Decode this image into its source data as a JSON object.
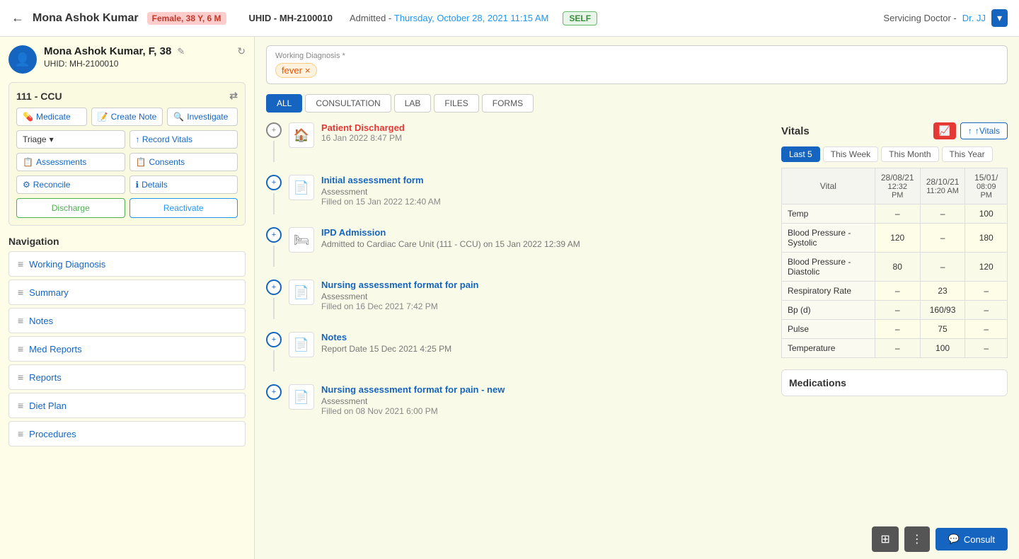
{
  "header": {
    "back_icon": "←",
    "patient_name": "Mona Ashok Kumar",
    "gender_badge": "Female, 38 Y, 6 M",
    "uhid_label": "UHID -",
    "uhid_value": "MH-2100010",
    "admitted_label": "Admitted -",
    "admitted_date": "Thursday, October 28, 2021 11:15 AM",
    "self_badge": "SELF",
    "servicing_label": "Servicing Doctor -",
    "servicing_doctor": "Dr. JJ",
    "dropdown_icon": "▾"
  },
  "patient_card": {
    "name": "Mona Ashok Kumar, F, 38",
    "uhid_prefix": "UHID:",
    "uhid": "MH-2100010",
    "edit_icon": "✎",
    "refresh_icon": "↻"
  },
  "ward": {
    "label": "111 - CCU",
    "transfer_icon": "⇄"
  },
  "actions": {
    "medicate": "Medicate",
    "create_note": "Create Note",
    "investigate": "Investigate",
    "triage": "Triage",
    "record_vitals": "↑ Record Vitals",
    "assessments": "Assessments",
    "consents": "Consents",
    "reconcile": "Reconcile",
    "details": "Details",
    "discharge": "Discharge",
    "reactivate": "Reactivate"
  },
  "navigation": {
    "title": "Navigation",
    "items": [
      {
        "id": "working-diagnosis",
        "label": "Working Diagnosis"
      },
      {
        "id": "summary",
        "label": "Summary"
      },
      {
        "id": "notes",
        "label": "Notes"
      },
      {
        "id": "med-reports",
        "label": "Med Reports"
      },
      {
        "id": "reports",
        "label": "Reports"
      },
      {
        "id": "diet-plan",
        "label": "Diet Plan"
      },
      {
        "id": "procedures",
        "label": "Procedures"
      }
    ]
  },
  "working_diagnosis": {
    "label": "Working Diagnosis *",
    "tag": "fever",
    "remove_icon": "×"
  },
  "tabs": {
    "items": [
      {
        "id": "all",
        "label": "ALL",
        "active": true
      },
      {
        "id": "consultation",
        "label": "CONSULTATION"
      },
      {
        "id": "lab",
        "label": "LAB"
      },
      {
        "id": "files",
        "label": "FILES"
      },
      {
        "id": "forms",
        "label": "FORMS"
      }
    ]
  },
  "timeline": {
    "items": [
      {
        "id": "patient-discharged",
        "title": "Patient Discharged",
        "title_type": "discharged",
        "icon": "🏠",
        "date": "16 Jan 2022 8:47 PM"
      },
      {
        "id": "initial-assessment",
        "title": "Initial assessment form",
        "title_type": "normal",
        "sub": "Assessment",
        "icon": "📄",
        "date": "Filled on 15 Jan 2022 12:40 AM"
      },
      {
        "id": "ipd-admission",
        "title": "IPD Admission",
        "title_type": "normal",
        "sub": "Admitted to Cardiac Care Unit (111 - CCU) on 15 Jan 2022 12:39 AM",
        "icon": "🛏"
      },
      {
        "id": "nursing-pain",
        "title": "Nursing assessment format for pain",
        "title_type": "normal",
        "sub": "Assessment",
        "icon": "📄",
        "date": "Filled on 16 Dec 2021 7:42 PM"
      },
      {
        "id": "notes",
        "title": "Notes",
        "title_type": "normal",
        "sub": "Report Date 15 Dec 2021 4:25 PM",
        "icon": "📄"
      },
      {
        "id": "nursing-pain-new",
        "title": "Nursing assessment format for pain - new",
        "title_type": "normal",
        "sub": "Assessment",
        "icon": "📄",
        "date": "Filled on 08 Nov 2021 6:00 PM"
      }
    ]
  },
  "vitals": {
    "title": "Vitals",
    "trend_btn_icon": "📈",
    "add_btn": "↑Vitals",
    "period_tabs": [
      {
        "label": "Last 5",
        "active": true
      },
      {
        "label": "This Week"
      },
      {
        "label": "This Month"
      },
      {
        "label": "This Year"
      }
    ],
    "columns": [
      "Vital",
      "28/08/21\n12:32 PM",
      "28/10/21\n11:20 AM",
      "15/01/\n08:09 PM"
    ],
    "col1_date": "28/08/21",
    "col1_time": "12:32 PM",
    "col2_date": "28/10/21",
    "col2_time": "11:20 AM",
    "col3_date": "15/01/",
    "col3_time": "08:09 PM",
    "rows": [
      {
        "name": "Temp",
        "v1": "–",
        "v2": "–",
        "v3": "100"
      },
      {
        "name": "Blood Pressure - Systolic",
        "v1": "120",
        "v2": "–",
        "v3": "180"
      },
      {
        "name": "Blood Pressure - Diastolic",
        "v1": "80",
        "v2": "–",
        "v3": "120"
      },
      {
        "name": "Respiratory Rate",
        "v1": "–",
        "v2": "23",
        "v3": "–"
      },
      {
        "name": "Bp (d)",
        "v1": "–",
        "v2": "160/93",
        "v3": "–"
      },
      {
        "name": "Pulse",
        "v1": "–",
        "v2": "75",
        "v3": "–"
      },
      {
        "name": "Temperature",
        "v1": "–",
        "v2": "100",
        "v3": "–"
      }
    ]
  },
  "medications": {
    "title": "Medications"
  },
  "bottom_bar": {
    "grid_icon": "⊞",
    "more_icon": "⋮",
    "consult_icon": "💬",
    "consult_label": "Consult"
  }
}
